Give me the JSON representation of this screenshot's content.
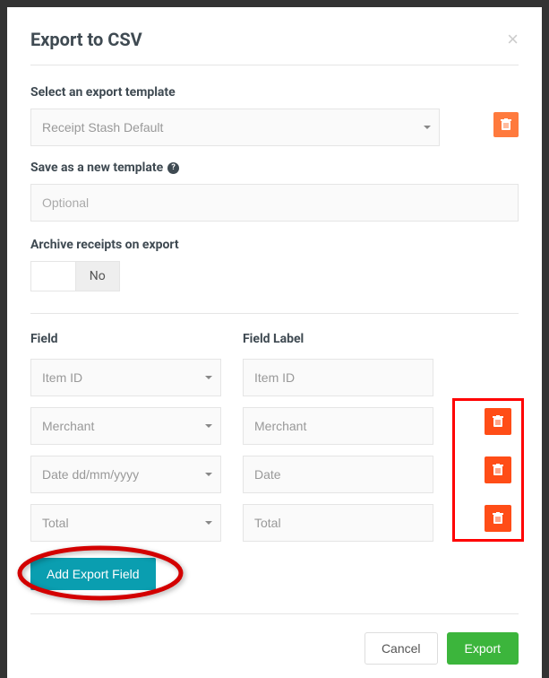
{
  "modal": {
    "title": "Export to CSV"
  },
  "template_select": {
    "label": "Select an export template",
    "value": "Receipt Stash Default"
  },
  "save_template": {
    "label": "Save as a new template",
    "placeholder": "Optional"
  },
  "archive": {
    "label": "Archive receipts on export",
    "no_label": "No"
  },
  "fields_header": {
    "field": "Field",
    "label": "Field Label"
  },
  "fields": [
    {
      "field": "Item ID",
      "label": "Item ID",
      "deletable": false
    },
    {
      "field": "Merchant",
      "label": "Merchant",
      "deletable": true
    },
    {
      "field": "Date dd/mm/yyyy",
      "label": "Date",
      "deletable": true
    },
    {
      "field": "Total",
      "label": "Total",
      "deletable": true
    }
  ],
  "buttons": {
    "add_field": "Add Export Field",
    "cancel": "Cancel",
    "export": "Export"
  }
}
